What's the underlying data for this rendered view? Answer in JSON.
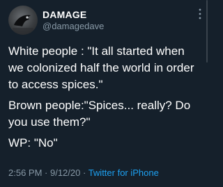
{
  "author": {
    "display_name": "DAMAGE",
    "handle": "@damagedave",
    "avatar_icon": "bird-silhouette-avatar"
  },
  "tweet": {
    "paragraphs": [
      "White people : \"It all started when we colonized half the world in order to access spices.\"",
      "Brown people:\"Spices... really? Do you use them?\"",
      "WP: \"No\""
    ]
  },
  "meta": {
    "time": "2:56 PM",
    "separator_1": " · ",
    "date": "9/12/20",
    "separator_2": " · ",
    "source": "Twitter for iPhone"
  },
  "colors": {
    "background": "#15202b",
    "text": "#ffffff",
    "secondary_text": "#8899a6",
    "link": "#1da1f2"
  }
}
